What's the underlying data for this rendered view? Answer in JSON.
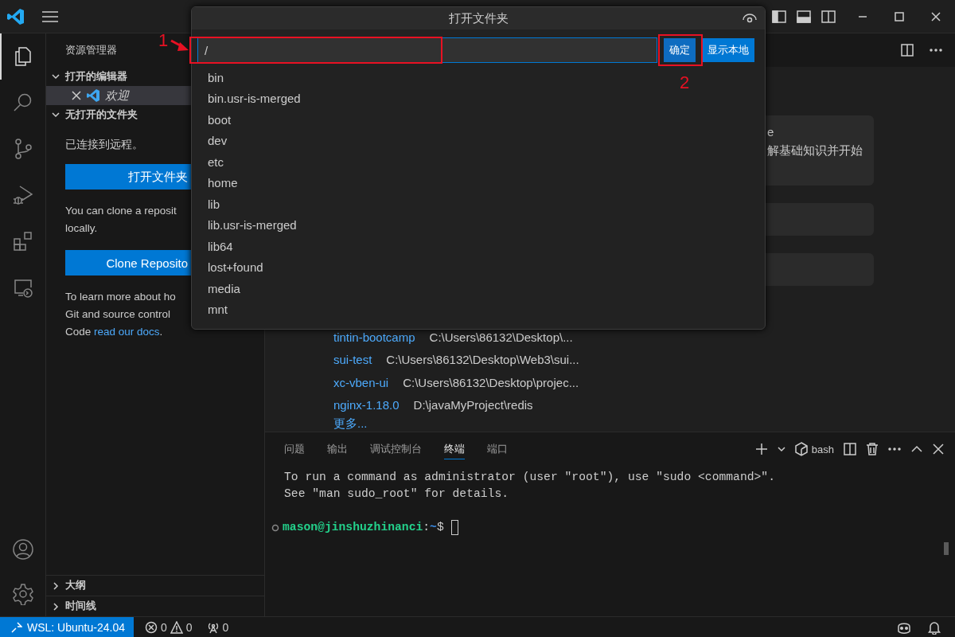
{
  "activity_bar": {
    "items": [
      {
        "kind": "explorer",
        "selected": true
      },
      {
        "kind": "search",
        "selected": false
      },
      {
        "kind": "source-control",
        "selected": false
      },
      {
        "kind": "run-debug",
        "selected": false
      },
      {
        "kind": "extensions",
        "selected": false
      },
      {
        "kind": "remote",
        "selected": false
      }
    ],
    "bottom": [
      {
        "kind": "accounts"
      },
      {
        "kind": "settings"
      }
    ]
  },
  "sidebar": {
    "title": "资源管理器",
    "open_editors": {
      "title": "打开的编辑器",
      "expanded": true,
      "items": [
        {
          "name": "欢迎",
          "selected": true
        }
      ]
    },
    "folder_section": {
      "title": "无打开的文件夹",
      "expanded": true,
      "status": "已连接到远程。",
      "open_button": "打开文件夹",
      "clone_text": "You can clone a reposit\nlocally.",
      "clone_button": "Clone Reposito",
      "learn_text": "To learn more about ho\nGit and source control\nCode ",
      "learn_link": "read our docs",
      "learn_after": "."
    },
    "bottom_sections": [
      {
        "title": "大纲",
        "expanded": false
      },
      {
        "title": "时间线",
        "expanded": false
      }
    ]
  },
  "welcome": {
    "cards": [
      {
        "kind": "walkthrough",
        "title": "e",
        "description": "解基础知识并开始"
      },
      {
        "kind": "blank"
      },
      {
        "kind": "blank"
      }
    ],
    "recent": [
      {
        "name": "tintin-bootcamp",
        "path": "C:\\Users\\86132\\Desktop\\..."
      },
      {
        "name": "sui-test",
        "path": "C:\\Users\\86132\\Desktop\\Web3\\sui..."
      },
      {
        "name": "xc-vben-ui",
        "path": "C:\\Users\\86132\\Desktop\\projec..."
      },
      {
        "name": "nginx-1.18.0",
        "path": "D:\\javaMyProject\\redis"
      }
    ],
    "more": "更多..."
  },
  "panel": {
    "tabs": [
      {
        "label": "问题",
        "selected": false
      },
      {
        "label": "输出",
        "selected": false
      },
      {
        "label": "调试控制台",
        "selected": false
      },
      {
        "label": "终端",
        "selected": true
      },
      {
        "label": "端口",
        "selected": false
      }
    ],
    "shell": "bash",
    "terminal": {
      "lines": [
        "To run a command as administrator (user \"root\"), use \"sudo <command>\".",
        "See \"man sudo_root\" for details."
      ],
      "prompt": {
        "user_host": "mason@jinshuzhinanci",
        "separator": ":",
        "path": "~",
        "symbol": "$"
      }
    }
  },
  "status_bar": {
    "remote": "WSL: Ubuntu-24.04",
    "errors": "0",
    "warnings": "0",
    "ports": "0"
  },
  "dialog": {
    "title": "打开文件夹",
    "input_value": "/",
    "buttons": [
      {
        "label": "确定",
        "kind": "primary"
      },
      {
        "label": "显示本地",
        "kind": "secondary"
      }
    ],
    "items": [
      "bin",
      "bin.usr-is-merged",
      "boot",
      "dev",
      "etc",
      "home",
      "lib",
      "lib.usr-is-merged",
      "lib64",
      "lost+found",
      "media",
      "mnt"
    ]
  },
  "annotations": [
    {
      "label": "1"
    },
    {
      "label": "2"
    }
  ]
}
